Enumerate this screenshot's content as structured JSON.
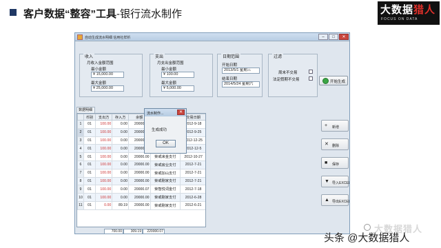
{
  "slide": {
    "title_bold": "客户数据“整容”工具",
    "title_rest": "-银行流水制作",
    "brand_main_a": "大数据",
    "brand_main_b": "猎人",
    "brand_sub": "FOCUS ON DATA",
    "watermark": "头条 @大数据猎人",
    "watermark_faint": "大数据猎人"
  },
  "window": {
    "title": "自动生成流水明细 信用社样析",
    "minimize": "–",
    "maximize": "□",
    "close": "✕"
  },
  "income": {
    "group_label": "收入",
    "range_label": "月收入金额范围",
    "min_label": "最小金额",
    "min_value": "¥ 15,000.00",
    "max_label": "最大金额",
    "max_value": "¥ 25,000.00"
  },
  "expense": {
    "group_label": "支出",
    "range_label": "月支出金额范围",
    "min_label": "最小金额",
    "min_value": "¥ 100.00",
    "max_label": "最大金额",
    "max_value": "¥ 5,000.00"
  },
  "date_range": {
    "group_label": "日期范围",
    "start_label": "开始日期",
    "start_value": "2013/5/1 星期三",
    "end_label": "结束日期",
    "end_value": "2014/5/24 星期六"
  },
  "filter": {
    "group_label": "过滤",
    "weekend_label": "周末不交易",
    "holiday_label": "法定假期不交易"
  },
  "generate_button": "开始生成",
  "tab_label": "数据明细",
  "table": {
    "headers": [
      "币别",
      "支出方",
      "存入方",
      "余额",
      "备注",
      "交易日期"
    ],
    "rows": [
      [
        "1",
        "01",
        "100.00",
        "0.00",
        "20000.00",
        "柴或房业支付",
        "2012-9-18"
      ],
      [
        "2",
        "01",
        "100.00",
        "0.00",
        "20000.00",
        "柴或房山支付",
        "2012-9-25"
      ],
      [
        "3",
        "01",
        "100.00",
        "0.00",
        "20000.00",
        "柴或房业支付",
        "2012-12-25"
      ],
      [
        "4",
        "01",
        "100.00",
        "0.00",
        "20000.00",
        "柴或房业支付",
        "2012-12-5"
      ],
      [
        "5",
        "01",
        "100.00",
        "0.00",
        "20000.00",
        "柴或来金支付",
        "2012-10-27"
      ],
      [
        "6",
        "01",
        "100.00",
        "0.00",
        "20000.00",
        "柴或房业支付",
        "2012-7-21"
      ],
      [
        "7",
        "01",
        "100.00",
        "0.00",
        "20000.00",
        "柴或加山支付",
        "2012-7-21"
      ],
      [
        "8",
        "01",
        "100.00",
        "0.00",
        "20000.00",
        "柴或剔家支付",
        "2012-7-21"
      ],
      [
        "9",
        "01",
        "100.00",
        "0.00",
        "20000.07",
        "柴智悦词金付",
        "2012-7-18"
      ],
      [
        "10",
        "01",
        "100.00",
        "0.00",
        "20000.00",
        "柴或剔家支付",
        "2012-6-28"
      ],
      [
        "11",
        "01",
        "0.00",
        "89.19",
        "20000.00",
        "柴或剔家支付",
        "2012-6-21"
      ]
    ],
    "totals": [
      "700.00",
      "309.19",
      "220000.07"
    ]
  },
  "side_buttons": [
    {
      "icon": "+",
      "label": "新增",
      "name": "add-button"
    },
    {
      "icon": "✕",
      "label": "删除",
      "name": "delete-button"
    },
    {
      "icon": "■",
      "label": "保存",
      "name": "save-button"
    },
    {
      "icon": "▼",
      "label": "导入EXCEL",
      "name": "import-excel-button"
    },
    {
      "icon": "▲",
      "label": "导出EXCEL",
      "name": "export-excel-button"
    }
  ],
  "dialog": {
    "title": "流水制作...",
    "close": "✕",
    "message": "生成成功",
    "ok": "OK"
  },
  "colors": {
    "accent": "#1f3864",
    "brand_red": "#e0302a",
    "window_bg": "#dfe6ee",
    "close_red": "#c9463d"
  }
}
